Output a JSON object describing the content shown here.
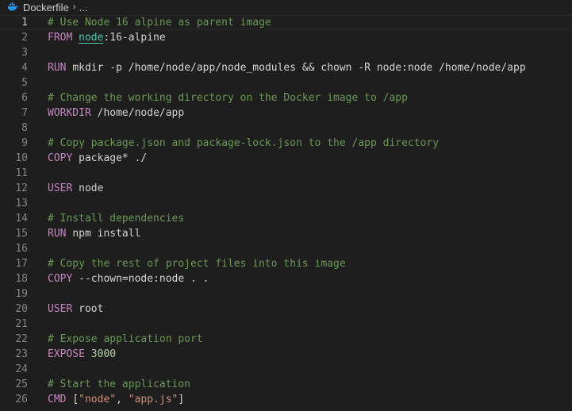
{
  "breadcrumb": {
    "file": "Dockerfile",
    "separator": "›",
    "rest": "..."
  },
  "current_line": 1,
  "lines": [
    {
      "n": "1",
      "tokens": [
        {
          "t": "# Use Node 16 alpine as parent image",
          "c": "cmt"
        }
      ]
    },
    {
      "n": "2",
      "tokens": [
        {
          "t": "FROM ",
          "c": "kw"
        },
        {
          "t": "node",
          "c": "img"
        },
        {
          "t": ":16-alpine",
          "c": "arg"
        }
      ]
    },
    {
      "n": "3",
      "tokens": []
    },
    {
      "n": "4",
      "tokens": [
        {
          "t": "RUN ",
          "c": "kw"
        },
        {
          "t": "mkdir -p /home/node/app/node_modules && chown -R node:node /home/node/app",
          "c": "arg"
        }
      ]
    },
    {
      "n": "5",
      "tokens": []
    },
    {
      "n": "6",
      "tokens": [
        {
          "t": "# Change the working directory on the Docker image to /app",
          "c": "cmt"
        }
      ]
    },
    {
      "n": "7",
      "tokens": [
        {
          "t": "WORKDIR ",
          "c": "kw"
        },
        {
          "t": "/home/node/app",
          "c": "arg"
        }
      ]
    },
    {
      "n": "8",
      "tokens": []
    },
    {
      "n": "9",
      "tokens": [
        {
          "t": "# Copy package.json and package-lock.json to the /app directory",
          "c": "cmt"
        }
      ]
    },
    {
      "n": "10",
      "tokens": [
        {
          "t": "COPY ",
          "c": "kw"
        },
        {
          "t": "package* ./",
          "c": "arg"
        }
      ]
    },
    {
      "n": "11",
      "tokens": []
    },
    {
      "n": "12",
      "tokens": [
        {
          "t": "USER ",
          "c": "kw"
        },
        {
          "t": "node",
          "c": "arg"
        }
      ]
    },
    {
      "n": "13",
      "tokens": []
    },
    {
      "n": "14",
      "tokens": [
        {
          "t": "# Install dependencies",
          "c": "cmt"
        }
      ]
    },
    {
      "n": "15",
      "tokens": [
        {
          "t": "RUN ",
          "c": "kw"
        },
        {
          "t": "npm install",
          "c": "arg"
        }
      ]
    },
    {
      "n": "16",
      "tokens": []
    },
    {
      "n": "17",
      "tokens": [
        {
          "t": "# Copy the rest of project files into this image",
          "c": "cmt"
        }
      ]
    },
    {
      "n": "18",
      "tokens": [
        {
          "t": "COPY ",
          "c": "kw"
        },
        {
          "t": "--chown=node:node . .",
          "c": "arg"
        }
      ]
    },
    {
      "n": "19",
      "tokens": []
    },
    {
      "n": "20",
      "tokens": [
        {
          "t": "USER ",
          "c": "kw"
        },
        {
          "t": "root",
          "c": "arg"
        }
      ]
    },
    {
      "n": "21",
      "tokens": []
    },
    {
      "n": "22",
      "tokens": [
        {
          "t": "# Expose application port",
          "c": "cmt"
        }
      ]
    },
    {
      "n": "23",
      "tokens": [
        {
          "t": "EXPOSE ",
          "c": "kw"
        },
        {
          "t": "3000",
          "c": "num"
        }
      ]
    },
    {
      "n": "24",
      "tokens": []
    },
    {
      "n": "25",
      "tokens": [
        {
          "t": "# Start the application",
          "c": "cmt"
        }
      ]
    },
    {
      "n": "26",
      "tokens": [
        {
          "t": "CMD ",
          "c": "kw"
        },
        {
          "t": "[",
          "c": "arg"
        },
        {
          "t": "\"node\"",
          "c": "str"
        },
        {
          "t": ", ",
          "c": "arg"
        },
        {
          "t": "\"app.js\"",
          "c": "str"
        },
        {
          "t": "]",
          "c": "arg"
        }
      ]
    }
  ],
  "colors": {
    "background": "#1e1e1e",
    "comment": "#6a9955",
    "keyword": "#c586c0",
    "text": "#d4d4d4",
    "string": "#ce9178",
    "number": "#b5cea8",
    "image": "#4ec9b0",
    "line_number": "#858585",
    "docker_icon": "#2496ed"
  },
  "icons": {
    "breadcrumb_file": "docker-whale-icon",
    "breadcrumb_separator": "chevron-right-icon"
  }
}
